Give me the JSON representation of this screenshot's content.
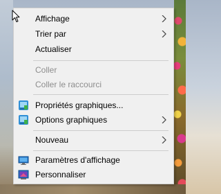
{
  "context_menu": {
    "items": [
      {
        "label": "Affichage",
        "has_submenu": true,
        "enabled": true,
        "icon": ""
      },
      {
        "label": "Trier par",
        "has_submenu": true,
        "enabled": true,
        "icon": ""
      },
      {
        "label": "Actualiser",
        "has_submenu": false,
        "enabled": true,
        "icon": ""
      },
      {
        "label": "Coller",
        "has_submenu": false,
        "enabled": false,
        "icon": ""
      },
      {
        "label": "Coller le raccourci",
        "has_submenu": false,
        "enabled": false,
        "icon": ""
      },
      {
        "label": "Propriétés graphiques...",
        "has_submenu": false,
        "enabled": true,
        "icon": "intel-graphics-icon"
      },
      {
        "label": "Options graphiques",
        "has_submenu": true,
        "enabled": true,
        "icon": "intel-graphics-icon"
      },
      {
        "label": "Nouveau",
        "has_submenu": true,
        "enabled": true,
        "icon": ""
      },
      {
        "label": "Paramètres d'affichage",
        "has_submenu": false,
        "enabled": true,
        "icon": "display-settings-icon"
      },
      {
        "label": "Personnaliser",
        "has_submenu": false,
        "enabled": true,
        "icon": "personalize-icon"
      }
    ]
  },
  "colors": {
    "menu_background": "#f0f0f0",
    "disabled_text": "#8d8d8d",
    "separator": "#cdcdcd"
  }
}
